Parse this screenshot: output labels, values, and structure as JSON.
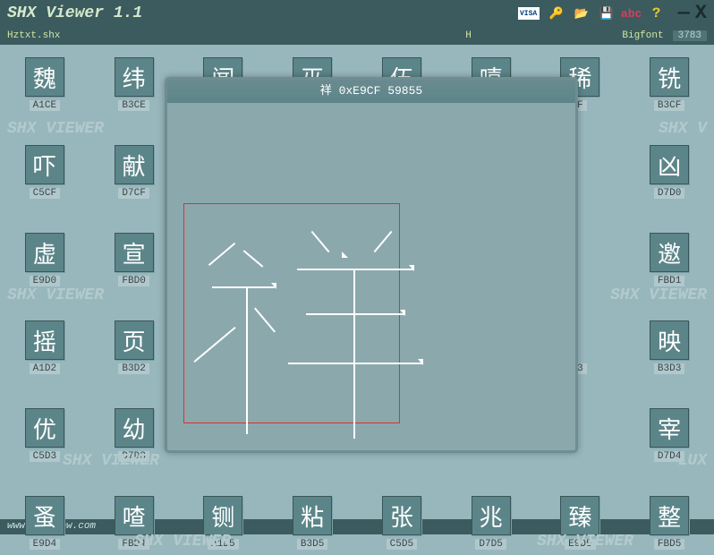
{
  "header": {
    "title": "SHX Viewer 1.1"
  },
  "toolbar": {
    "visa": "VISA",
    "key": "🔑",
    "open": "📂",
    "save": "💾",
    "abc": "abc",
    "help": "?"
  },
  "win": {
    "min": "—",
    "close": "X"
  },
  "infobar": {
    "file": "Hztxt.shx",
    "center": "H",
    "type": "Bigfont",
    "count": "3783"
  },
  "grid": [
    [
      {
        "g": "魏",
        "c": "A1CE"
      },
      {
        "g": "纬",
        "c": "B3CE"
      },
      {
        "g": "闻",
        "c": ""
      },
      {
        "g": "巫",
        "c": ""
      },
      {
        "g": "伍",
        "c": ""
      },
      {
        "g": "嘻",
        "c": ""
      },
      {
        "g": "稀",
        "c": "F"
      },
      {
        "g": "铣",
        "c": "B3CF"
      }
    ],
    [
      {
        "g": "吓",
        "c": "C5CF"
      },
      {
        "g": "献",
        "c": "D7CF"
      },
      {
        "g": "",
        "c": ""
      },
      {
        "g": "",
        "c": ""
      },
      {
        "g": "",
        "c": ""
      },
      {
        "g": "",
        "c": ""
      },
      {
        "g": "",
        "c": ""
      },
      {
        "g": "凶",
        "c": "D7D0"
      }
    ],
    [
      {
        "g": "虚",
        "c": "E9D0"
      },
      {
        "g": "宣",
        "c": "FBD0"
      },
      {
        "g": "",
        "c": ""
      },
      {
        "g": "",
        "c": ""
      },
      {
        "g": "",
        "c": ""
      },
      {
        "g": "",
        "c": ""
      },
      {
        "g": "",
        "c": ""
      },
      {
        "g": "邀",
        "c": "FBD1"
      }
    ],
    [
      {
        "g": "摇",
        "c": "A1D2"
      },
      {
        "g": "页",
        "c": "B3D2"
      },
      {
        "g": "",
        "c": ""
      },
      {
        "g": "",
        "c": ""
      },
      {
        "g": "",
        "c": ""
      },
      {
        "g": "",
        "c": ""
      },
      {
        "g": "",
        "c": "3"
      },
      {
        "g": "映",
        "c": "B3D3"
      }
    ],
    [
      {
        "g": "优",
        "c": "C5D3"
      },
      {
        "g": "幼",
        "c": "D7D3"
      },
      {
        "g": "",
        "c": ""
      },
      {
        "g": "",
        "c": ""
      },
      {
        "g": "",
        "c": ""
      },
      {
        "g": "",
        "c": ""
      },
      {
        "g": "",
        "c": ""
      },
      {
        "g": "宰",
        "c": "D7D4"
      }
    ],
    [
      {
        "g": "蚤",
        "c": "E9D4"
      },
      {
        "g": "喳",
        "c": "FBD4"
      },
      {
        "g": "铡",
        "c": "A1D5"
      },
      {
        "g": "粘",
        "c": "B3D5"
      },
      {
        "g": "张",
        "c": "C5D5"
      },
      {
        "g": "兆",
        "c": "D7D5"
      },
      {
        "g": "臻",
        "c": "E9D5"
      },
      {
        "g": "整",
        "c": "FBD5"
      }
    ]
  ],
  "dialog": {
    "title": "祥 0xE9CF 59855"
  },
  "footer": {
    "url": "www.shxview.com"
  },
  "chart_data": null
}
